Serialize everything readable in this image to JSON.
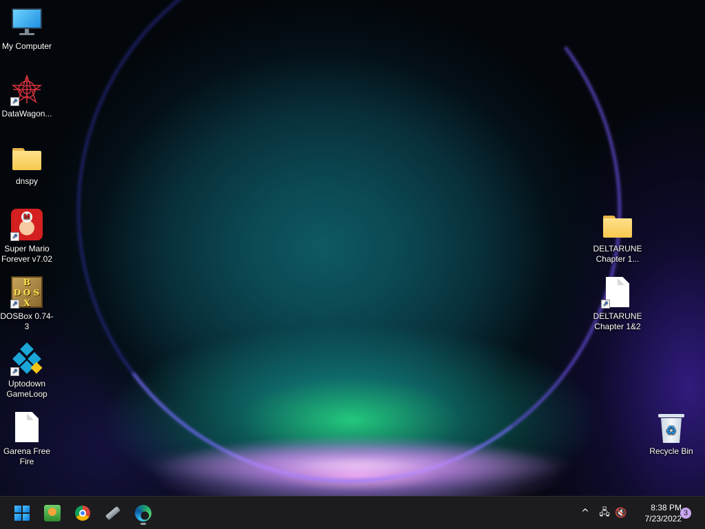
{
  "desktop": {
    "icons": [
      {
        "label": "My Computer",
        "icon": "computer-icon"
      },
      {
        "label": "DataWagon...",
        "icon": "datawagon-icon"
      },
      {
        "label": "dnspy",
        "icon": "folder-icon"
      },
      {
        "label": "Super Mario Forever v7.02",
        "icon": "mario-icon"
      },
      {
        "label": "DOSBox 0.74-3",
        "icon": "dosbox-icon"
      },
      {
        "label": "Uptodown GameLoop",
        "icon": "gameloop-icon"
      },
      {
        "label": "Garena Free Fire",
        "icon": "document-icon"
      },
      {
        "label": "DELTARUNE Chapter 1...",
        "icon": "folder-icon"
      },
      {
        "label": "DELTARUNE Chapter 1&2",
        "icon": "document-icon"
      },
      {
        "label": "Recycle Bin",
        "icon": "recycle-bin-icon"
      }
    ],
    "dosbox_letters": [
      "B",
      "D",
      "O",
      "S",
      "X"
    ],
    "shortcut_glyph": "↗",
    "mario_letter": "M",
    "recycle_glyph": "♻"
  },
  "taskbar": {
    "apps": [
      {
        "name": "Start",
        "icon": "windows-start-icon"
      },
      {
        "name": "Photo app",
        "icon": "picture-app-icon"
      },
      {
        "name": "Google Chrome",
        "icon": "chrome-icon"
      },
      {
        "name": "USB tool",
        "icon": "usb-drive-icon"
      },
      {
        "name": "Microsoft Edge",
        "icon": "edge-icon"
      }
    ],
    "tray": {
      "chevron": "^",
      "network_glyph": "🖧",
      "volume_glyph": "🔇",
      "time": "8:38 PM",
      "date": "7/23/2022",
      "notification_count": "3"
    }
  },
  "colors": {
    "taskbar_bg": "#1c1c1f",
    "accent": "#0a7ad8",
    "folder": "#f6c94f",
    "notification": "#c9a7f0"
  }
}
